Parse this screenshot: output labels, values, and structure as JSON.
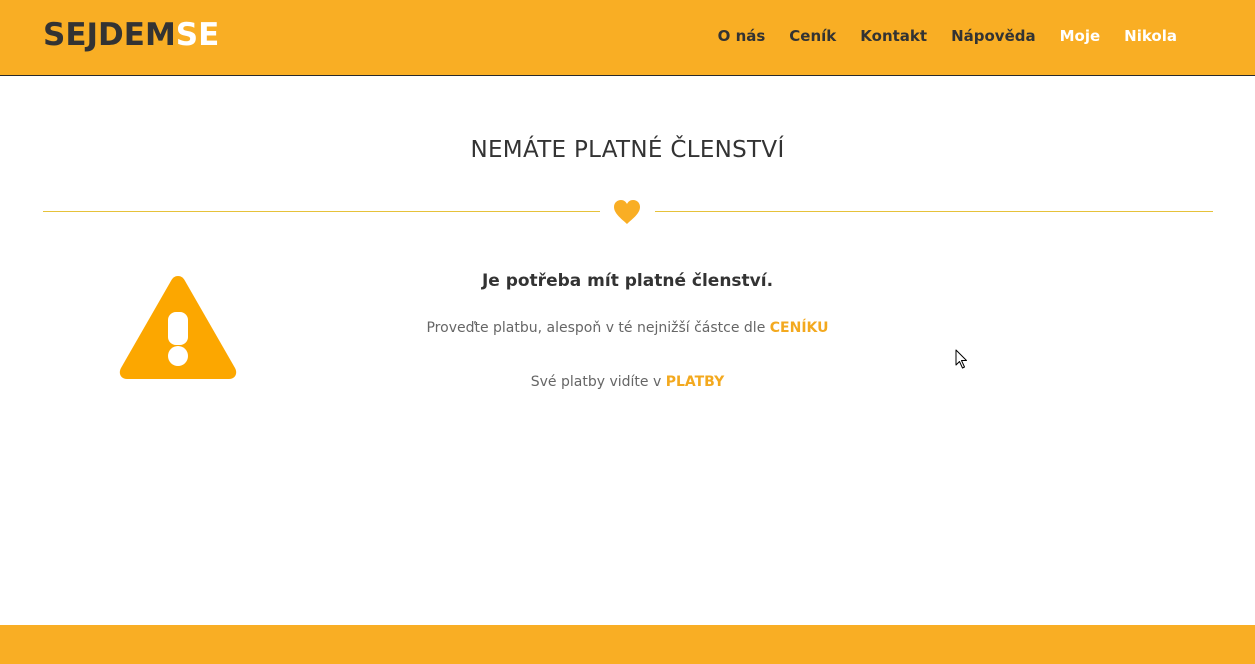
{
  "header": {
    "logo_part1": "SEJDEM",
    "logo_part2": "SE",
    "nav": [
      "O nás",
      "Ceník",
      "Kontakt",
      "Nápověda",
      "Moje",
      "Nikola"
    ]
  },
  "main": {
    "title": "NEMÁTE PLATNÉ ČLENSTVÍ",
    "heading": "Je potřeba mít platné členství.",
    "line1_text": "Proveďte platbu, alespoň v té nejnižší částce dle ",
    "line1_link": "CENÍKU",
    "line2_text": "Své platby vidíte v ",
    "line2_link": "PLATBY"
  },
  "icons": {
    "divider": "heart-icon",
    "alert": "warning-icon",
    "pointer": "mouse-cursor-icon"
  },
  "colors": {
    "brand": "#f9ae24",
    "warning": "#fca700",
    "text": "#333333",
    "link": "#f3a91f"
  }
}
